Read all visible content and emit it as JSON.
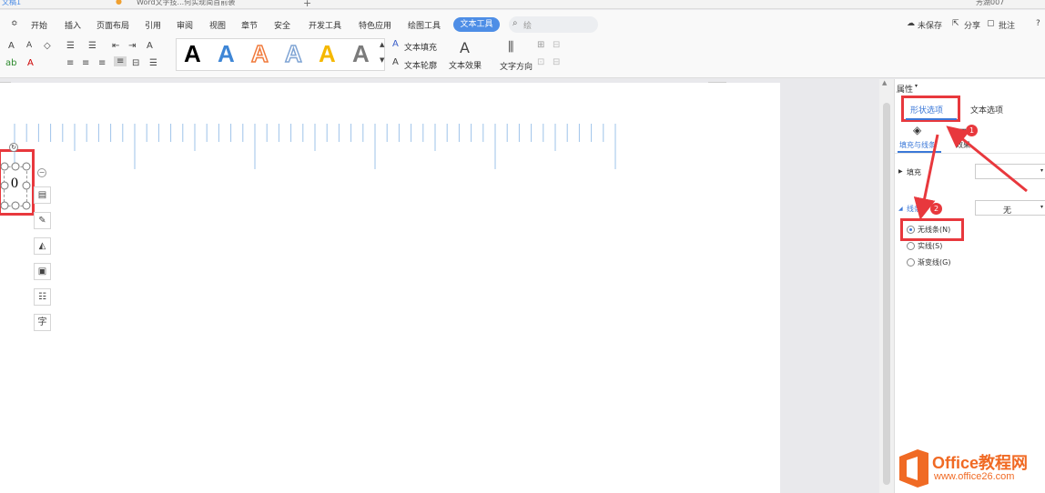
{
  "titlebar": {
    "doc1": "文稿1",
    "doc2": "Word文字技...何实现简首前袭",
    "user": "芳湖007",
    "help": "?"
  },
  "menu": {
    "items": [
      "开始",
      "插入",
      "页面布局",
      "引用",
      "审阅",
      "视图",
      "章节",
      "安全",
      "开发工具",
      "特色应用",
      "绘图工具"
    ],
    "active": "文本工具",
    "search": "绘",
    "unsaved": "未保存",
    "share": "分享",
    "comment": "批注"
  },
  "toolbar": {
    "font_a_up": "A",
    "font_a_down": "A",
    "text_fill": "文本填充",
    "text_outline": "文本轮廓",
    "text_effect": "文本效果",
    "text_direction": "文字方向",
    "style_letter": "A"
  },
  "textbox": {
    "value": "0"
  },
  "panel": {
    "title": "属性",
    "tab_shape": "形状选项",
    "tab_text": "文本选项",
    "fill_line_tab": "填充与线条",
    "effect_tab": "效果",
    "fill_label": "填充",
    "line_label": "线条",
    "line_value": "无",
    "options": [
      "无线条(N)",
      "实线(S)",
      "渐变线(G)"
    ],
    "badge1": "1",
    "badge2": "2"
  },
  "float_tools": [
    "layout-icon",
    "pen-icon",
    "fill-icon",
    "border-icon",
    "text-wrap-icon",
    "char-icon"
  ],
  "float_char": "字",
  "logo": {
    "brand": "Office教程网",
    "url": "www.office26.com"
  },
  "colors": {
    "accent": "#4e8ee6",
    "highlight": "#e8383d",
    "ruler": "#9ec3ea",
    "logo_orange": "#f06a24"
  }
}
